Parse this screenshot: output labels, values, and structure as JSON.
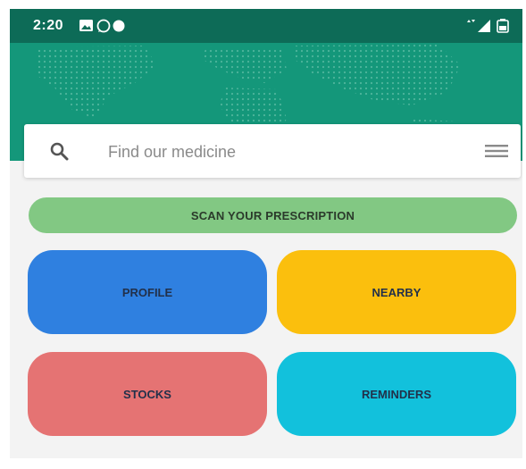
{
  "status_bar": {
    "time": "2:20",
    "left_icons": [
      "image-icon",
      "whatsapp-icon",
      "dot-icon"
    ],
    "right_icons": [
      "network-arrows-icon",
      "signal-icon",
      "battery-icon"
    ]
  },
  "colors": {
    "status_bar": "#0d6b57",
    "header": "#14977a",
    "scan": "#82c883",
    "profile": "#2f80e0",
    "nearby": "#fbbf0d",
    "stocks": "#e57373",
    "reminders": "#12c1dc"
  },
  "search": {
    "placeholder": "Find our medicine",
    "icon": "search-icon",
    "menu_icon": "hamburger-menu-icon"
  },
  "buttons": {
    "scan": "SCAN YOUR PRESCRIPTION",
    "profile": "PROFILE",
    "nearby": "NEARBY",
    "stocks": "STOCKS",
    "reminders": "REMINDERS"
  }
}
